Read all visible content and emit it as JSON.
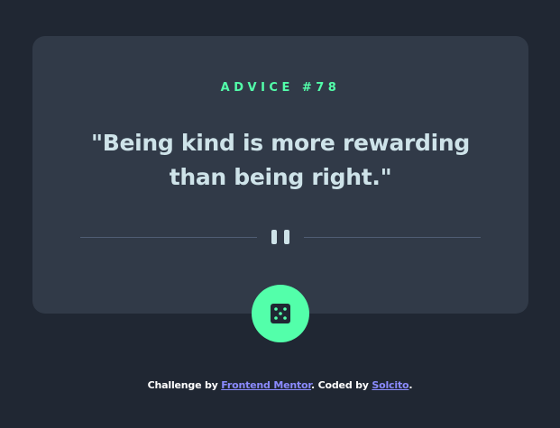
{
  "advice": {
    "label": "ADVICE #78",
    "quote": "\"Being kind is more rewarding than being right.\""
  },
  "divider": {
    "icon": "pause-icon"
  },
  "dice_button": {
    "icon": "dice-icon"
  },
  "attribution": {
    "prefix": "Challenge by ",
    "frontend_mentor": "Frontend Mentor",
    "middle": ". Coded by ",
    "author": "Solcito",
    "suffix": "."
  },
  "colors": {
    "background": "#202733",
    "card": "#313a48",
    "accent_green": "#53ffaa",
    "text_light": "#cee3e9",
    "divider": "#4f5d74",
    "link": "#8b8bff"
  }
}
